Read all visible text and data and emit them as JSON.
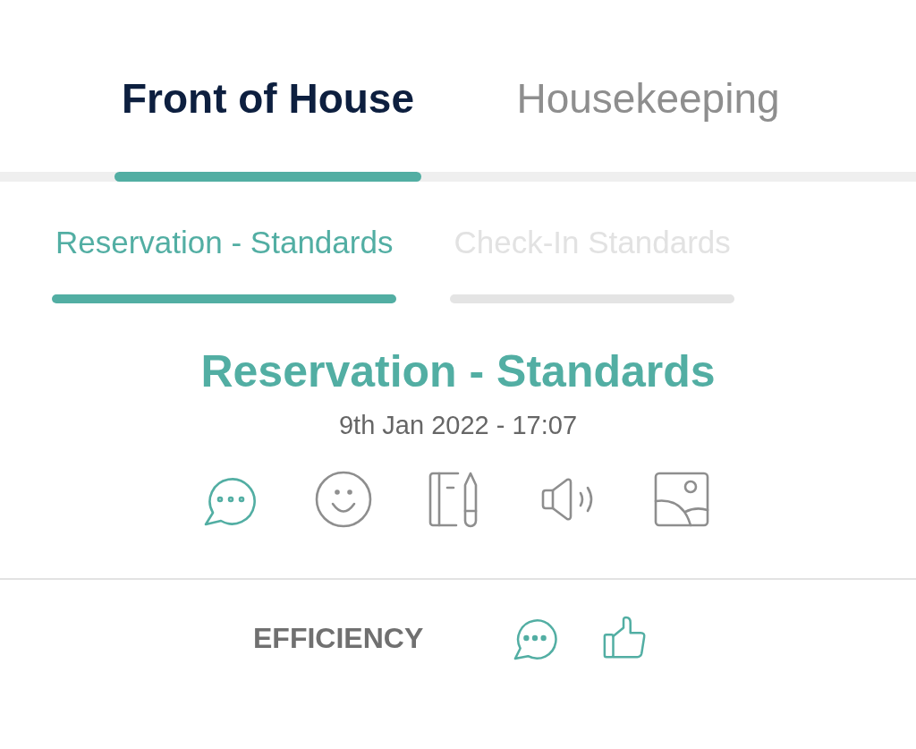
{
  "tabs": [
    {
      "label": "Front of House",
      "selected": true
    },
    {
      "label": "Housekeeping",
      "selected": false
    }
  ],
  "subtabs": [
    {
      "label": "Reservation - Standards",
      "selected": true
    },
    {
      "label": "Check-In Standards",
      "selected": false
    }
  ],
  "heading": "Reservation - Standards",
  "timestamp": "9th Jan 2022 - 17:07",
  "media_buttons": [
    {
      "kind": "comment",
      "selected": true
    },
    {
      "kind": "emoji",
      "selected": false
    },
    {
      "kind": "notes",
      "selected": false
    },
    {
      "kind": "audio",
      "selected": false
    },
    {
      "kind": "image",
      "selected": false
    }
  ],
  "category": {
    "label": "EFFICIENCY",
    "actions": [
      {
        "kind": "comment"
      },
      {
        "kind": "like"
      }
    ]
  }
}
